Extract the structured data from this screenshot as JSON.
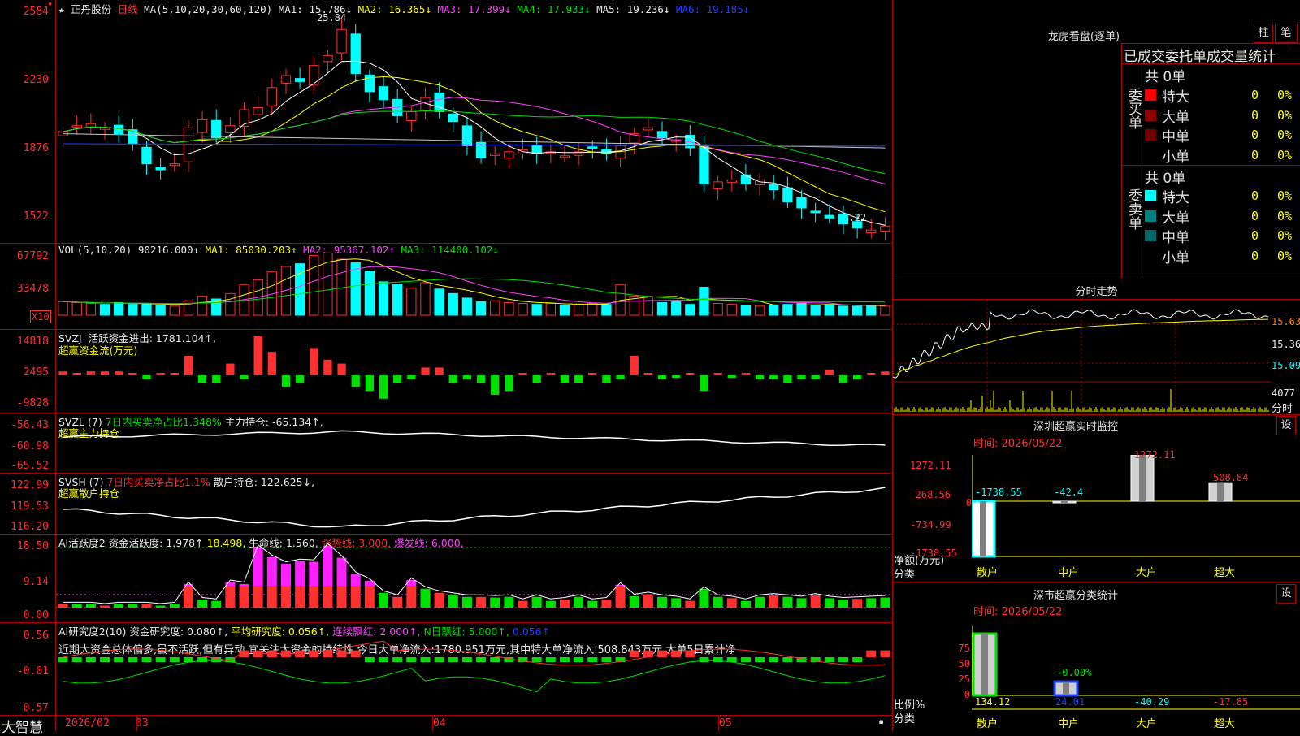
{
  "app": {
    "brand": "大智慧",
    "star_icon": "star-icon"
  },
  "main": {
    "stock_name": "正丹股份",
    "period": "日线",
    "ma_params": "MA(5,10,20,30,60,120)",
    "ma": [
      {
        "label": "MA1: 15.786↓",
        "color": "#ffffff"
      },
      {
        "label": "MA2: 16.365↓",
        "color": "#ffff00"
      },
      {
        "label": "MA3: 17.399↓",
        "color": "#ff40ff"
      },
      {
        "label": "MA4: 17.933↓",
        "color": "#00e000"
      },
      {
        "label": "MA5: 19.236↓",
        "color": "#c0c0c0"
      },
      {
        "label": "MA6: 19.185↓",
        "color": "#2040ff"
      }
    ],
    "y_ticks": [
      "2584",
      "2230",
      "1876",
      "1522"
    ],
    "high_label": "25.84",
    "low_label": "15.22"
  },
  "vol": {
    "title": "VOL(5,10,20)",
    "value": "90216.000↑",
    "ma1": "MA1: 85030.203↑",
    "ma2": "MA2: 95367.102↑",
    "ma3": "MA3: 114400.102↓",
    "y_ticks": [
      "67792",
      "33478"
    ],
    "unit": "X10"
  },
  "svzj": {
    "title": "SVZJ",
    "label": "活跃资金进出: 1781.104↑,",
    "sub": "超赢资金流(万元)",
    "y_ticks": [
      "14818",
      "2495",
      "-9828"
    ]
  },
  "svzl": {
    "title": "SVZL (7)",
    "label1": "7日内买卖净占比1.348%",
    "label2": "主力持仓: -65.134↑,",
    "sub": "超赢主力持仓",
    "y_ticks": [
      "-56.43",
      "-60.98",
      "-65.52"
    ]
  },
  "svsh": {
    "title": "SVSH (7)",
    "label1": "7日内买卖净占比1.1%",
    "label2": "散户持仓: 122.625↓,",
    "sub": "超赢散户持仓",
    "y_ticks": [
      "122.99",
      "119.53",
      "116.20"
    ]
  },
  "ai1": {
    "title": "AI活跃度2 资金活跃度: 1.978↑",
    "v2": "18.498,",
    "v3": "生命线: 1.560,",
    "v4": "强势线: 3.000,",
    "v5": "爆发线: 6.000,",
    "y_ticks": [
      "18.50",
      "9.14",
      "0.00"
    ]
  },
  "ai2": {
    "title": "AI研究度2(10) 资金研究度: 0.080↑,",
    "v2": "平均研究度: 0.056↑,",
    "v3": "连续飘红: 2.000↑,",
    "v4": "N日飘红: 5.000↑,",
    "v5": "0.056↑",
    "comment": "近期大资金总体偏多,虽不活跃,但有异动,宜关注大资金的持续性,今日大单净流入:1780.951万元,其中特大单净流入:508.843万元,大单5日累计净",
    "y_ticks": [
      "0.56",
      "-0.01",
      "-0.57"
    ]
  },
  "xaxis": [
    "2026/02",
    "03",
    "04",
    "05"
  ],
  "longhu": {
    "title": "龙虎看盘(逐单)",
    "btn1": "柱",
    "btn2": "笔",
    "tabs": "已成交委托单成交量统计",
    "buy_total": "共 0单",
    "sell_total": "共 0单",
    "buy_label": "委买单",
    "sell_label": "委卖单",
    "buy_rows": [
      {
        "name": "特大",
        "value": "0",
        "pct": "0%",
        "color": "#ff0000"
      },
      {
        "name": "大单",
        "value": "0",
        "pct": "0%",
        "color": "#900000"
      },
      {
        "name": "中单",
        "value": "0",
        "pct": "0%",
        "color": "#700000"
      },
      {
        "name": "小单",
        "value": "0",
        "pct": "0%",
        "color": "#000000"
      }
    ],
    "sell_rows": [
      {
        "name": "特大",
        "value": "0",
        "pct": "0%",
        "color": "#00ffff"
      },
      {
        "name": "大单",
        "value": "0",
        "pct": "0%",
        "color": "#008080"
      },
      {
        "name": "中单",
        "value": "0",
        "pct": "0%",
        "color": "#006868"
      },
      {
        "name": "小单",
        "value": "0",
        "pct": "0%",
        "color": "#000000"
      }
    ]
  },
  "fenshi": {
    "title": "分时走势",
    "right_ticks": [
      "15.63",
      "15.36",
      "15.09"
    ],
    "vol_tick": "4077",
    "vol_unit": "分时"
  },
  "sz_monitor": {
    "title": "深圳超赢实时监控",
    "btn": "设",
    "time": "时间: 2026/05/22",
    "y_ticks": [
      "1272.11",
      "268.56",
      "0",
      "-734.99",
      "-1738.55"
    ],
    "ylabel1": "净额(万元)",
    "ylabel2": "分类",
    "bars": [
      {
        "cat": "散户",
        "value": -1738.55,
        "label": "-1738.55"
      },
      {
        "cat": "中户",
        "value": -42.4,
        "label": "-42.4"
      },
      {
        "cat": "大户",
        "value": 1272.11,
        "label": "1272.11"
      },
      {
        "cat": "超大",
        "value": 508.84,
        "label": "508.84"
      }
    ]
  },
  "sz_class": {
    "title": "深市超赢分类统计",
    "btn": "设",
    "time": "时间: 2026/05/22",
    "y_ticks": [
      "75",
      "50",
      "25",
      "0"
    ],
    "ylabel1": "比例%",
    "ylabel2": "分类",
    "mid_label": "-0.00%",
    "bars": [
      {
        "cat": "散户",
        "value": 134.12,
        "label": "134.12"
      },
      {
        "cat": "中户",
        "value": 24.01,
        "label": "24.01"
      },
      {
        "cat": "大户",
        "value": -40.29,
        "label": "-40.29"
      },
      {
        "cat": "超大",
        "value": -17.85,
        "label": "-17.85"
      }
    ]
  },
  "chart_data": [
    {
      "type": "bar",
      "title": "深圳超赢实时监控",
      "categories": [
        "散户",
        "中户",
        "大户",
        "超大"
      ],
      "values": [
        -1738.55,
        -42.4,
        1272.11,
        508.84
      ],
      "ylabel": "净额(万元)"
    },
    {
      "type": "bar",
      "title": "深市超赢分类统计",
      "categories": [
        "散户",
        "中户",
        "大户",
        "超大"
      ],
      "values": [
        134.12,
        24.01,
        -40.29,
        -17.85
      ],
      "ylabel": "比例%"
    }
  ]
}
